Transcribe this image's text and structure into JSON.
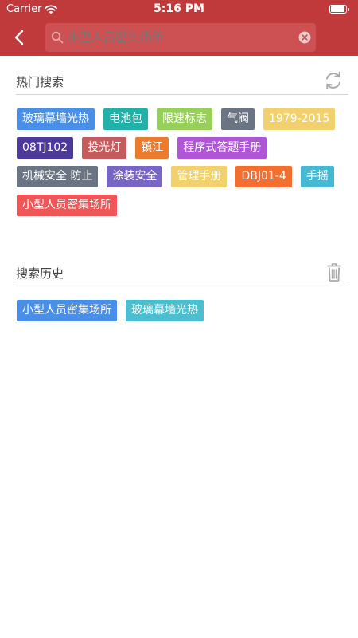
{
  "status_bar": {
    "carrier": "Carrier",
    "time": "5:16 PM"
  },
  "colors": {
    "header_bg": "#c0393b",
    "search_bg": "#cd5052"
  },
  "search": {
    "value": "",
    "placeholder": "小型人员密集场所"
  },
  "hot_search": {
    "title": "热门搜索",
    "refresh_icon": "refresh-icon",
    "tags": [
      {
        "label": "玻璃幕墙光热",
        "color": "#4a8fe7"
      },
      {
        "label": "电池包",
        "color": "#21b1a8"
      },
      {
        "label": "限速标志",
        "color": "#96cf5a"
      },
      {
        "label": "气阀",
        "color": "#6b7482"
      },
      {
        "label": "1979-2015",
        "color": "#f2d06e"
      },
      {
        "label": "08TJ102",
        "color": "#4b3a9c"
      },
      {
        "label": "投光灯",
        "color": "#c65b5e"
      },
      {
        "label": "镇江",
        "color": "#ee7a2d"
      },
      {
        "label": "程序式答题手册",
        "color": "#b055d8"
      },
      {
        "label": "机械安全 防止",
        "color": "#6a7482"
      },
      {
        "label": "涂装安全",
        "color": "#7766c4"
      },
      {
        "label": "管理手册",
        "color": "#f2d06e"
      },
      {
        "label": "DBJ01-4",
        "color": "#f46e2e"
      },
      {
        "label": "手摇",
        "color": "#45b9d4"
      },
      {
        "label": "小型人员密集场所",
        "color": "#f25555"
      }
    ]
  },
  "search_history": {
    "title": "搜索历史",
    "trash_icon": "trash-icon",
    "tags": [
      {
        "label": "小型人员密集场所",
        "color": "#4a8fe7"
      },
      {
        "label": "玻璃幕墙光热",
        "color": "#4bbfd0"
      }
    ]
  }
}
